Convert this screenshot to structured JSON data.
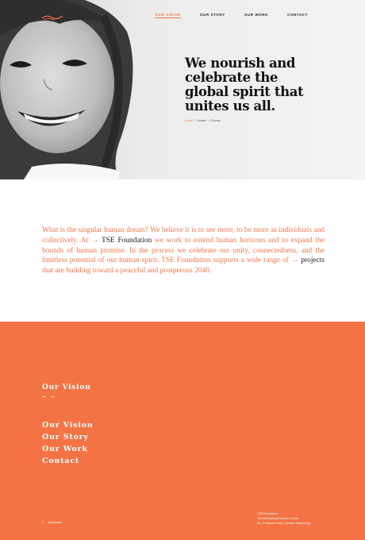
{
  "colors": {
    "accent": "#f37345",
    "text_dark": "#121212",
    "background": "#ffffff"
  },
  "nav": [
    {
      "label": "OUR VISION",
      "active": true
    },
    {
      "label": "OUR STORY",
      "active": false
    },
    {
      "label": "OUR WORK",
      "active": false
    },
    {
      "label": "CONTACT",
      "active": false
    }
  ],
  "hero": {
    "heading": "We nourish and celebrate the global spirit that unites us all.",
    "breadcrumb": {
      "home": "Home",
      "sep1": "/",
      "item1": "Contact",
      "sep2": "/",
      "item2": "Pictures"
    }
  },
  "intro": {
    "text_part1": "What is the singular human dream? We believe it is to see more, to be more as individuals and collectively. At ",
    "arrow1": "→",
    "link1": "TSE Foundation",
    "text_part2": " we work to extend human horizons and to expand the bounds of human promise. In the process we celebrate our unity, connectedness, and the limitless potential of our human spirit. TSE Foundation supports a wide range of ",
    "arrow2": "→",
    "link2": "projects",
    "text_part3": " that are building toward a peaceful and prosperous 2040."
  },
  "footer": {
    "section_title": "Our Vision",
    "menu": [
      "Our Vision",
      "Our Story",
      "Our Work",
      "Contact"
    ],
    "bottom_left": {
      "number": "1",
      "label": "Disclaimer"
    },
    "address": [
      "TSE Foundation",
      "Tse International Finance Centre",
      "No. 8 Finance Street, Central, Hong Kong"
    ]
  }
}
